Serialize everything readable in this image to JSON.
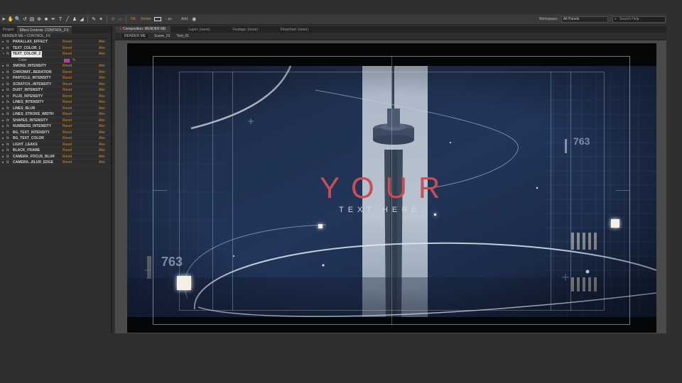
{
  "toolbar": {
    "tools": [
      "selection-tool",
      "hand-tool",
      "zoom-tool",
      "rotate-tool",
      "camera-tool",
      "pan-behind-tool",
      "rectangle-tool",
      "pen-tool",
      "type-tool",
      "brush-tool",
      "clone-stamp-tool",
      "eraser-tool",
      "roto-brush-tool",
      "puppet-tool"
    ],
    "fill_label": "Fill:",
    "stroke_label": "Stroke:",
    "stroke_width": "- px",
    "add_label": "Add:",
    "workspace_label": "Workspace:",
    "workspace_value": "All Panels",
    "search_placeholder": "Search Help"
  },
  "left_panel": {
    "tabs": [
      "Project",
      "Effect Controls: CONTROL_FX"
    ],
    "path": "RENDER ME • CONTROL_FX",
    "reset_label": "Reset",
    "about_label": "Abo",
    "effects": [
      "PARALLAX_EFFECT",
      "TEXT_COLOR_1",
      "TEXT_COLOR_2",
      "SMOKE_INTENSITY",
      "CHROMAT...BERATION",
      "PARTICLE_INTENSITY",
      "SCRATCH...INTENSITY",
      "DUST_INTENSITY",
      "PLUS_INTENSITY",
      "LINES_INTENSITY",
      "LINES_BLUR",
      "LINES_STROKE_WIDTH",
      "SHAPES_INTENSITY",
      "NUMBERS_INTENSITY",
      "BG_TEXT_INTENSITY",
      "BG_TEXT_COLOR",
      "LIGHT_LEAKS",
      "BLACK_FRAME",
      "CAMERA_FOCUS_BLUR",
      "CAMERA...BLUR_EDGE"
    ],
    "selected_effect": "TEXT_COLOR_2",
    "color_property": "Color",
    "color_value": "#e020c4"
  },
  "comp_panel": {
    "tabs": [
      "Composition: RENDER ME",
      "Layer: (none)",
      "Footage: (none)",
      "Flowchart: (none)"
    ],
    "breadcrumbs": [
      "RENDER ME",
      "Scene_01",
      "Text_01"
    ]
  },
  "preview": {
    "title": "YOUR",
    "subtitle": "TEXT HERE",
    "number_right": "763",
    "number_left": "763"
  },
  "colors": {
    "accent": "#d28b2f",
    "title_red": "#c84e55",
    "swatch_magenta": "#e020c4"
  }
}
